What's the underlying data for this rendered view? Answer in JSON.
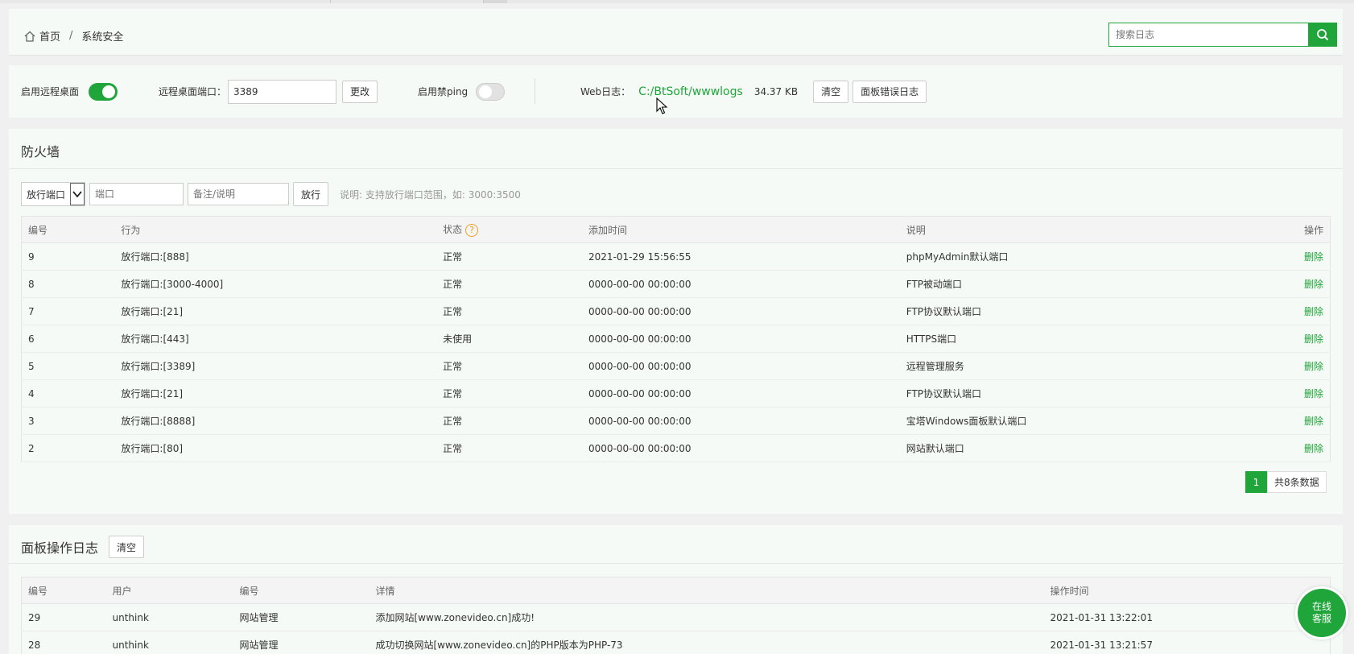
{
  "breadcrumb": {
    "home": "首页",
    "separator": "/",
    "current": "系统安全"
  },
  "search": {
    "placeholder": "搜索日志"
  },
  "remote": {
    "enable_label": "启用远程桌面",
    "port_label": "远程桌面端口：",
    "port_value": "3389",
    "change_label": "更改",
    "ping_label": "启用禁ping",
    "web_log_label": "Web日志：",
    "web_log_path": "C:/BtSoft/wwwlogs",
    "web_log_size": "34.37 KB",
    "clear_label": "清空",
    "panel_error_log_label": "面板错误日志"
  },
  "firewall": {
    "title": "防火墙",
    "select_value": "放行端口",
    "port_placeholder": "端口",
    "note_placeholder": "备注/说明",
    "allow_label": "放行",
    "hint": "说明: 支持放行端口范围，如: 3000:3500",
    "headers": [
      "编号",
      "行为",
      "状态",
      "添加时间",
      "说明",
      "操作"
    ],
    "rows": [
      {
        "id": "9",
        "action": "放行端口:[888]",
        "status": "正常",
        "time": "2021-01-29 15:56:55",
        "note": "phpMyAdmin默认端口",
        "op": "删除"
      },
      {
        "id": "8",
        "action": "放行端口:[3000-4000]",
        "status": "正常",
        "time": "0000-00-00 00:00:00",
        "note": "FTP被动端口",
        "op": "删除"
      },
      {
        "id": "7",
        "action": "放行端口:[21]",
        "status": "正常",
        "time": "0000-00-00 00:00:00",
        "note": "FTP协议默认端口",
        "op": "删除"
      },
      {
        "id": "6",
        "action": "放行端口:[443]",
        "status": "未使用",
        "time": "0000-00-00 00:00:00",
        "note": "HTTPS端口",
        "op": "删除"
      },
      {
        "id": "5",
        "action": "放行端口:[3389]",
        "status": "正常",
        "time": "0000-00-00 00:00:00",
        "note": "远程管理服务",
        "op": "删除"
      },
      {
        "id": "4",
        "action": "放行端口:[21]",
        "status": "正常",
        "time": "0000-00-00 00:00:00",
        "note": "FTP协议默认端口",
        "op": "删除"
      },
      {
        "id": "3",
        "action": "放行端口:[8888]",
        "status": "正常",
        "time": "0000-00-00 00:00:00",
        "note": "宝塔Windows面板默认端口",
        "op": "删除"
      },
      {
        "id": "2",
        "action": "放行端口:[80]",
        "status": "正常",
        "time": "0000-00-00 00:00:00",
        "note": "网站默认端口",
        "op": "删除"
      }
    ],
    "pager": {
      "current": "1",
      "total": "共8条数据"
    }
  },
  "oplog": {
    "title": "面板操作日志",
    "clear_label": "清空",
    "headers": [
      "编号",
      "用户",
      "编号",
      "详情",
      "操作时间"
    ],
    "rows": [
      {
        "id": "29",
        "user": "unthink",
        "type": "网站管理",
        "detail": "添加网站[www.zonevideo.cn]成功!",
        "time": "2021-01-31 13:22:01"
      },
      {
        "id": "28",
        "user": "unthink",
        "type": "网站管理",
        "detail": "成功切换网站[www.zonevideo.cn]的PHP版本为PHP-73",
        "time": "2021-01-31 13:21:57"
      }
    ]
  },
  "float_service": {
    "line1": "在线",
    "line2": "客服"
  },
  "colors": {
    "accent": "#20a53a",
    "help": "#f0a020"
  },
  "icons": {
    "home": "home-icon",
    "search": "search-icon",
    "help": "help-icon",
    "dropdown": "chevron-down-icon",
    "cursor": "mouse-cursor-icon"
  }
}
